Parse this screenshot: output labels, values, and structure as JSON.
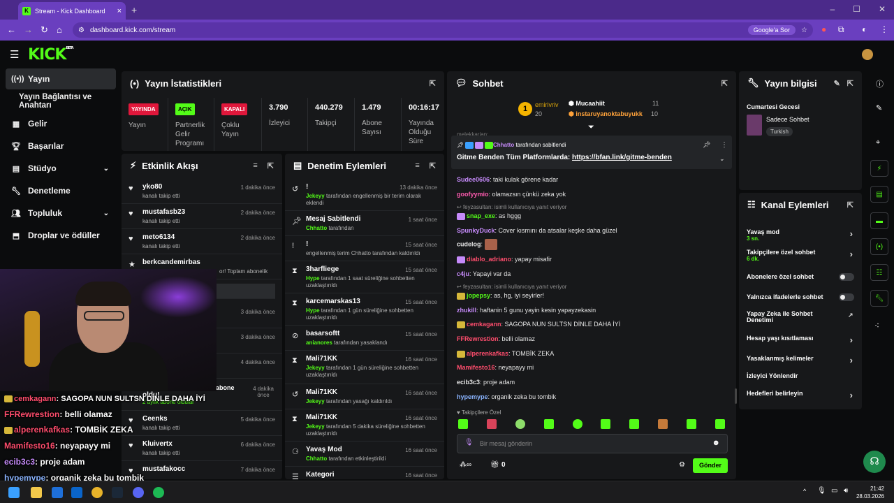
{
  "browser": {
    "tab_title": "Stream - Kick Dashboard",
    "url": "dashboard.kick.com/stream",
    "google_button": "Google'a Sor",
    "new_tab": "+"
  },
  "brand": {
    "logo": "KICK",
    "beta": "BETA",
    "accent": "#53fc18"
  },
  "sidebar": [
    {
      "label": "Yayın",
      "icon": "broadcast-icon"
    },
    {
      "label": "Yayın Bağlantısı ve Anahtarı"
    },
    {
      "label": "Gelir",
      "icon": "revenue-icon"
    },
    {
      "label": "Başarılar",
      "icon": "trophy-icon"
    },
    {
      "label": "Stüdyo",
      "icon": "studio-icon"
    },
    {
      "label": "Denetleme",
      "icon": "wrench-icon"
    },
    {
      "label": "Topluluk",
      "icon": "community-icon"
    },
    {
      "label": "Droplar ve ödüller",
      "icon": "drops-icon"
    }
  ],
  "stats": {
    "title": "Yayın İstatistikleri",
    "cols": [
      {
        "badge": "YAYINDA",
        "label": "Yayın"
      },
      {
        "badge": "AÇIK",
        "label": "Partnerlik Gelir Programı"
      },
      {
        "badge": "KAPALI",
        "label": "Çoklu Yayın"
      },
      {
        "value": "3.790",
        "label": "İzleyici"
      },
      {
        "value": "440.279",
        "label": "Takipçi"
      },
      {
        "value": "1.479",
        "label": "Abone Sayısı"
      },
      {
        "value": "00:16:17",
        "label": "Yayında Olduğu Süre"
      }
    ]
  },
  "activity": {
    "title": "Etkinlik Akışı",
    "items": [
      {
        "name": "yko80",
        "sub": "kanalı takip etti",
        "time": "1 dakika önce"
      },
      {
        "name": "mustafasb23",
        "sub": "kanalı takip etti",
        "time": "2 dakika önce"
      },
      {
        "name": "meto6134",
        "sub": "kanalı takip etti",
        "time": "2 dakika önce"
      },
      {
        "name": "berkcandemirbas",
        "sub": "or! Toplam abonelik",
        "time": ""
      },
      {
        "name": "",
        "sub": "",
        "time": "3 dakika önce"
      },
      {
        "name": "",
        "sub": "",
        "time": "3 dakika önce"
      },
      {
        "name": "",
        "sub": "",
        "time": "4 dakika önce"
      },
      {
        "name": "oldu!",
        "sub": "2 aylık abone oldular",
        "time": "4 dakika önce",
        "extra": "abone"
      },
      {
        "name": "Ceenks",
        "sub": "kanalı takip etti",
        "time": "5 dakika önce"
      },
      {
        "name": "Kluivertx",
        "sub": "kanalı takip etti",
        "time": "6 dakika önce"
      },
      {
        "name": "mustafakocc",
        "sub": "",
        "time": "7 dakika önce"
      }
    ]
  },
  "moderation": {
    "title": "Denetim Eylemleri",
    "items": [
      {
        "icon": "undo-icon",
        "title": "!",
        "user": "Jekeyy",
        "text": "tarafından engellenmiş bir terim olarak eklendi",
        "time": "13 dakika önce"
      },
      {
        "icon": "pin-icon",
        "title": "Mesaj Sabitlendi",
        "user": "Chhatto",
        "text": "tarafından",
        "time": "1 saat önce"
      },
      {
        "icon": "exclaim-icon",
        "title": "!",
        "user": "",
        "text": "engellenmiş terim Chhatto tarafından kaldırıldı",
        "time": "15 saat önce"
      },
      {
        "icon": "hourglass-icon",
        "title": "3harfliege",
        "user": "Hype",
        "text": "tarafından 1 saat süreliğine sohbetten uzaklaştırıldı",
        "time": "15 saat önce"
      },
      {
        "icon": "hourglass-icon",
        "title": "karcemarskas13",
        "user": "Hype",
        "text": "tarafından 1 gün süreliğine sohbetten uzaklaştırıldı",
        "time": "15 saat önce"
      },
      {
        "icon": "ban-icon",
        "title": "basarsoftt",
        "user": "anianores",
        "text": "tarafından yasaklandı",
        "time": "15 saat önce"
      },
      {
        "icon": "hourglass-icon",
        "title": "Mali71KK",
        "user": "Jekeyy",
        "text": "tarafından 1 gün süreliğine sohbetten uzaklaştırıldı",
        "time": "16 saat önce"
      },
      {
        "icon": "undo-icon",
        "title": "Mali71KK",
        "user": "Jekeyy",
        "text": "tarafından yasağı kaldırıldı",
        "time": "16 saat önce"
      },
      {
        "icon": "hourglass-icon",
        "title": "Mali71KK",
        "user": "Jekeyy",
        "text": "tarafından 5 dakika süreliğine sohbetten uzaklaştırıldı",
        "time": "16 saat önce"
      },
      {
        "icon": "slow-icon",
        "title": "Yavaş Mod",
        "user": "Chhatto",
        "text": "tarafından etkinleştirildi",
        "time": "16 saat önce"
      },
      {
        "icon": "list-icon",
        "title": "Kategori",
        "user": "",
        "text": "",
        "time": "16 saat önce"
      }
    ]
  },
  "chat": {
    "title": "Sohbet",
    "leaders": [
      {
        "rank": "1",
        "name": "emirivriv",
        "points": "20"
      },
      {
        "name": "Mucaahiit",
        "points": "11"
      },
      {
        "name": "instaruyanoktabuyukk",
        "points": "10"
      }
    ],
    "partial": "melekkarian: ...",
    "pinned": {
      "by": "Chhatto",
      "label": "tarafından sabitlendi",
      "text": "Gitme Benden Tüm Platformlarda:",
      "link": "https://bfan.link/gitme-benden"
    },
    "messages": [
      {
        "user": "Sudee0606",
        "color": "#c58af9",
        "text": "taki kulak görene kadar"
      },
      {
        "user": "goofyymio",
        "color": "#ff5bb0",
        "text": "olamazsın çünkü zeka yok"
      },
      {
        "reply": "feyzasultan: isimli kullanıcıya yanıt veriyor"
      },
      {
        "user": "snap_exe",
        "color": "#53fc18",
        "text": "as hggg",
        "badge": true
      },
      {
        "user": "SpunkyDuck",
        "color": "#c58af9",
        "text": "Cover kısmını da atsalar keşke daha güzel"
      },
      {
        "user": "cudelog",
        "color": "#ffffff",
        "text": "",
        "emote": true
      },
      {
        "user": "diablo_adriano",
        "color": "#ff4d6d",
        "text": "yapay misafir",
        "badge": true
      },
      {
        "user": "c4ju",
        "color": "#c58af9",
        "text": "Yapayi var da"
      },
      {
        "reply": "feyzasultan: isimli kullanıcıya yanıt veriyor"
      },
      {
        "user": "jopepsy",
        "color": "#53fc18",
        "text": "as, hg, iyi seyirler!",
        "badge": true
      },
      {
        "user": "zhukill",
        "color": "#c58af9",
        "text": "haftanin 5 gunu yayin kesin yapayzekasin"
      },
      {
        "user": "cemkagann",
        "color": "#ff4d6d",
        "text": "SAGOPA NUN SULTSN DİNLE DAHA İYİ",
        "badge": true
      },
      {
        "user": "FFRewrestion",
        "color": "#ff4d6d",
        "text": "belli olamaz"
      },
      {
        "user": "alperenkafkas",
        "color": "#ff4d6d",
        "text": "TOMBİK ZEKA",
        "badge": true
      },
      {
        "user": "Mamifesto16",
        "color": "#ff4d6d",
        "text": "neyapayy mi"
      },
      {
        "user": "ecib3c3",
        "color": "#ffffff",
        "text": "proje adam"
      },
      {
        "user": "hypemype",
        "color": "#8ab4ff",
        "text": "organik zeka bu tombik"
      }
    ],
    "followers_only": "Takipçilere Özel",
    "input_placeholder": "Bir mesaj gönderin",
    "points": "0",
    "send": "Gönder"
  },
  "stream_info": {
    "title": "Yayın bilgisi",
    "stream_title": "Cumartesi Gecesi",
    "category": "Sadece Sohbet",
    "tag": "Turkish"
  },
  "channel_actions": {
    "title": "Kanal Eylemleri",
    "items": [
      {
        "label": "Yavaş mod",
        "sub": "3 sn.",
        "control": "arrow"
      },
      {
        "label": "Takipçilere özel sohbet",
        "sub": "6 dk.",
        "control": "arrow"
      },
      {
        "label": "Abonelere özel sohbet",
        "control": "toggle"
      },
      {
        "label": "Yalnızca ifadelerle sohbet",
        "control": "toggle"
      },
      {
        "label": "Yapay Zeka ile Sohbet Denetimi",
        "control": "external"
      },
      {
        "label": "Hesap yaşı kısıtlaması",
        "control": "arrow"
      },
      {
        "label": "Yasaklanmış kelimeler",
        "control": "arrow"
      },
      {
        "label": "İzleyici Yönlendir"
      },
      {
        "label": "Hedefleri belirleyin",
        "control": "arrow"
      }
    ]
  },
  "overlay_chat": [
    {
      "user": "cemkagann",
      "text": ": SAGOPA NUN SULTSN DİNLE DAHA İYİ",
      "color": "#ff4d6d"
    },
    {
      "user": "FFRewrestion",
      "text": ": belli olamaz",
      "color": "#ff4d6d"
    },
    {
      "user": "alperenkafkas",
      "text": ": TOMBİK ZEKA",
      "color": "#ff4d6d"
    },
    {
      "user": "Mamifesto16",
      "text": ": neyapayy mi",
      "color": "#ff4d6d"
    },
    {
      "user": "ecib3c3",
      "text": ": proje adam",
      "color": "#c58af9"
    },
    {
      "user": "hypemype",
      "text": ": organik zeka bu tombik",
      "color": "#8ab4ff"
    }
  ],
  "taskbar": {
    "time": "21:42",
    "date": "28.03.2026"
  }
}
